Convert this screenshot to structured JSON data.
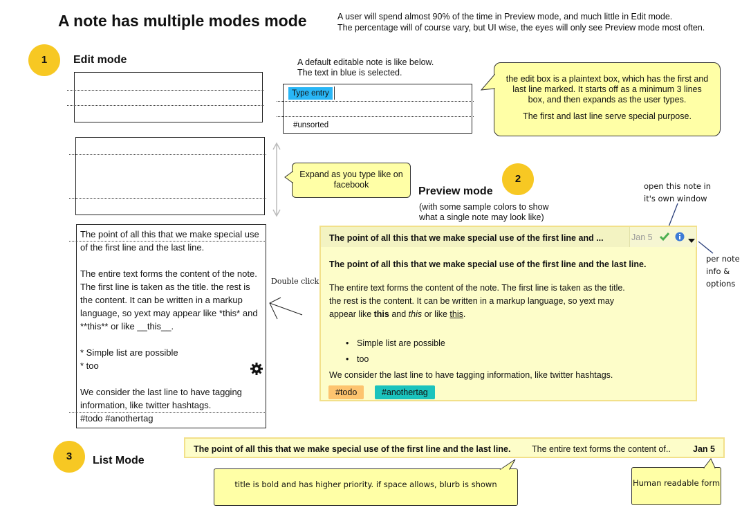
{
  "header": {
    "title": "A note has multiple modes mode",
    "intro_line1": "A user will spend almost 90% of the time in Preview mode, and much little in Edit mode.",
    "intro_line2": "The percentage will of course vary, but UI wise, the eyes will only see Preview mode most often."
  },
  "sections": {
    "edit": {
      "number": "1",
      "label": "Edit mode"
    },
    "preview": {
      "number": "2",
      "label": "Preview mode",
      "sub1": "(with some sample colors to show",
      "sub2": "what a single note may look like)"
    },
    "list": {
      "number": "3",
      "label": "List Mode"
    }
  },
  "edit_example": {
    "caption1": "A default editable note is like below.",
    "caption2": "The text in blue is selected.",
    "selected_text": "Type entry",
    "last_line": "#unsorted"
  },
  "callouts": {
    "edit_box_1": "the edit box is a plaintext box, which has the first and last line marked. It starts off as a minimum 3 lines box, and then expands as the user types.",
    "edit_box_2": "The first and last line serve special purpose.",
    "expand": "Expand as you type like on facebook",
    "list_title": "title is bold and has higher priority. if space allows, blurb is shown",
    "human_readable": "Human readable form"
  },
  "annotations": {
    "double_click": "Double click",
    "open_window_1": "open this note in",
    "open_window_2": "it's own window",
    "per_note_1": "per note",
    "per_note_2": "info &",
    "per_note_3": "options"
  },
  "edit_note": {
    "line1": "The point of all this that we make special use",
    "line2": "of the first line and the last line.",
    "p2_1": "The entire text forms the content of the note.",
    "p2_2": "The first line is taken as the title. the rest is",
    "p2_3": "the content. It can be written in a markup",
    "p2_4": "language, so yext may appear like *this* and",
    "p2_5": "**this** or like __this__.",
    "list1": "* Simple list are possible",
    "list2": "* too",
    "p3_1": "We consider the last line to have tagging",
    "p3_2": "information, like twitter hashtags.",
    "tags_line": "#todo #anothertag"
  },
  "preview_note": {
    "header_title": "The point of all this that we make special use of the first line and ...",
    "date": "Jan 5",
    "title": "The point of all this that we make special use of the first line and the last line.",
    "body1": "The entire text forms the content of the note. The first line is taken as the title.",
    "body2": "the rest is the content. It can be written in a markup language, so yext may",
    "body3_a": "appear like ",
    "body3_b": "this",
    "body3_c": " and ",
    "body3_d": "this",
    "body3_e": " or like ",
    "body3_f": "this",
    "body3_g": ".",
    "list": [
      "Simple list are possible",
      "too"
    ],
    "last": "We consider the last line to have tagging information, like twitter hashtags.",
    "tags": [
      "#todo",
      "#anothertag"
    ]
  },
  "list_row": {
    "title": "The point of all this that we make special use of the first line and the last line.",
    "blurb": "The entire text forms the content of..",
    "date": "Jan 5"
  },
  "colors": {
    "accent_circle": "#f7c823",
    "callout_bg": "#ffffa6",
    "preview_bg": "#fdfdc9",
    "selection": "#29b6f6",
    "tag_todo": "#fdc46f",
    "tag_another": "#1bc3bd"
  },
  "icons": [
    "gear-icon",
    "check-icon",
    "info-icon",
    "caret-down-icon"
  ]
}
